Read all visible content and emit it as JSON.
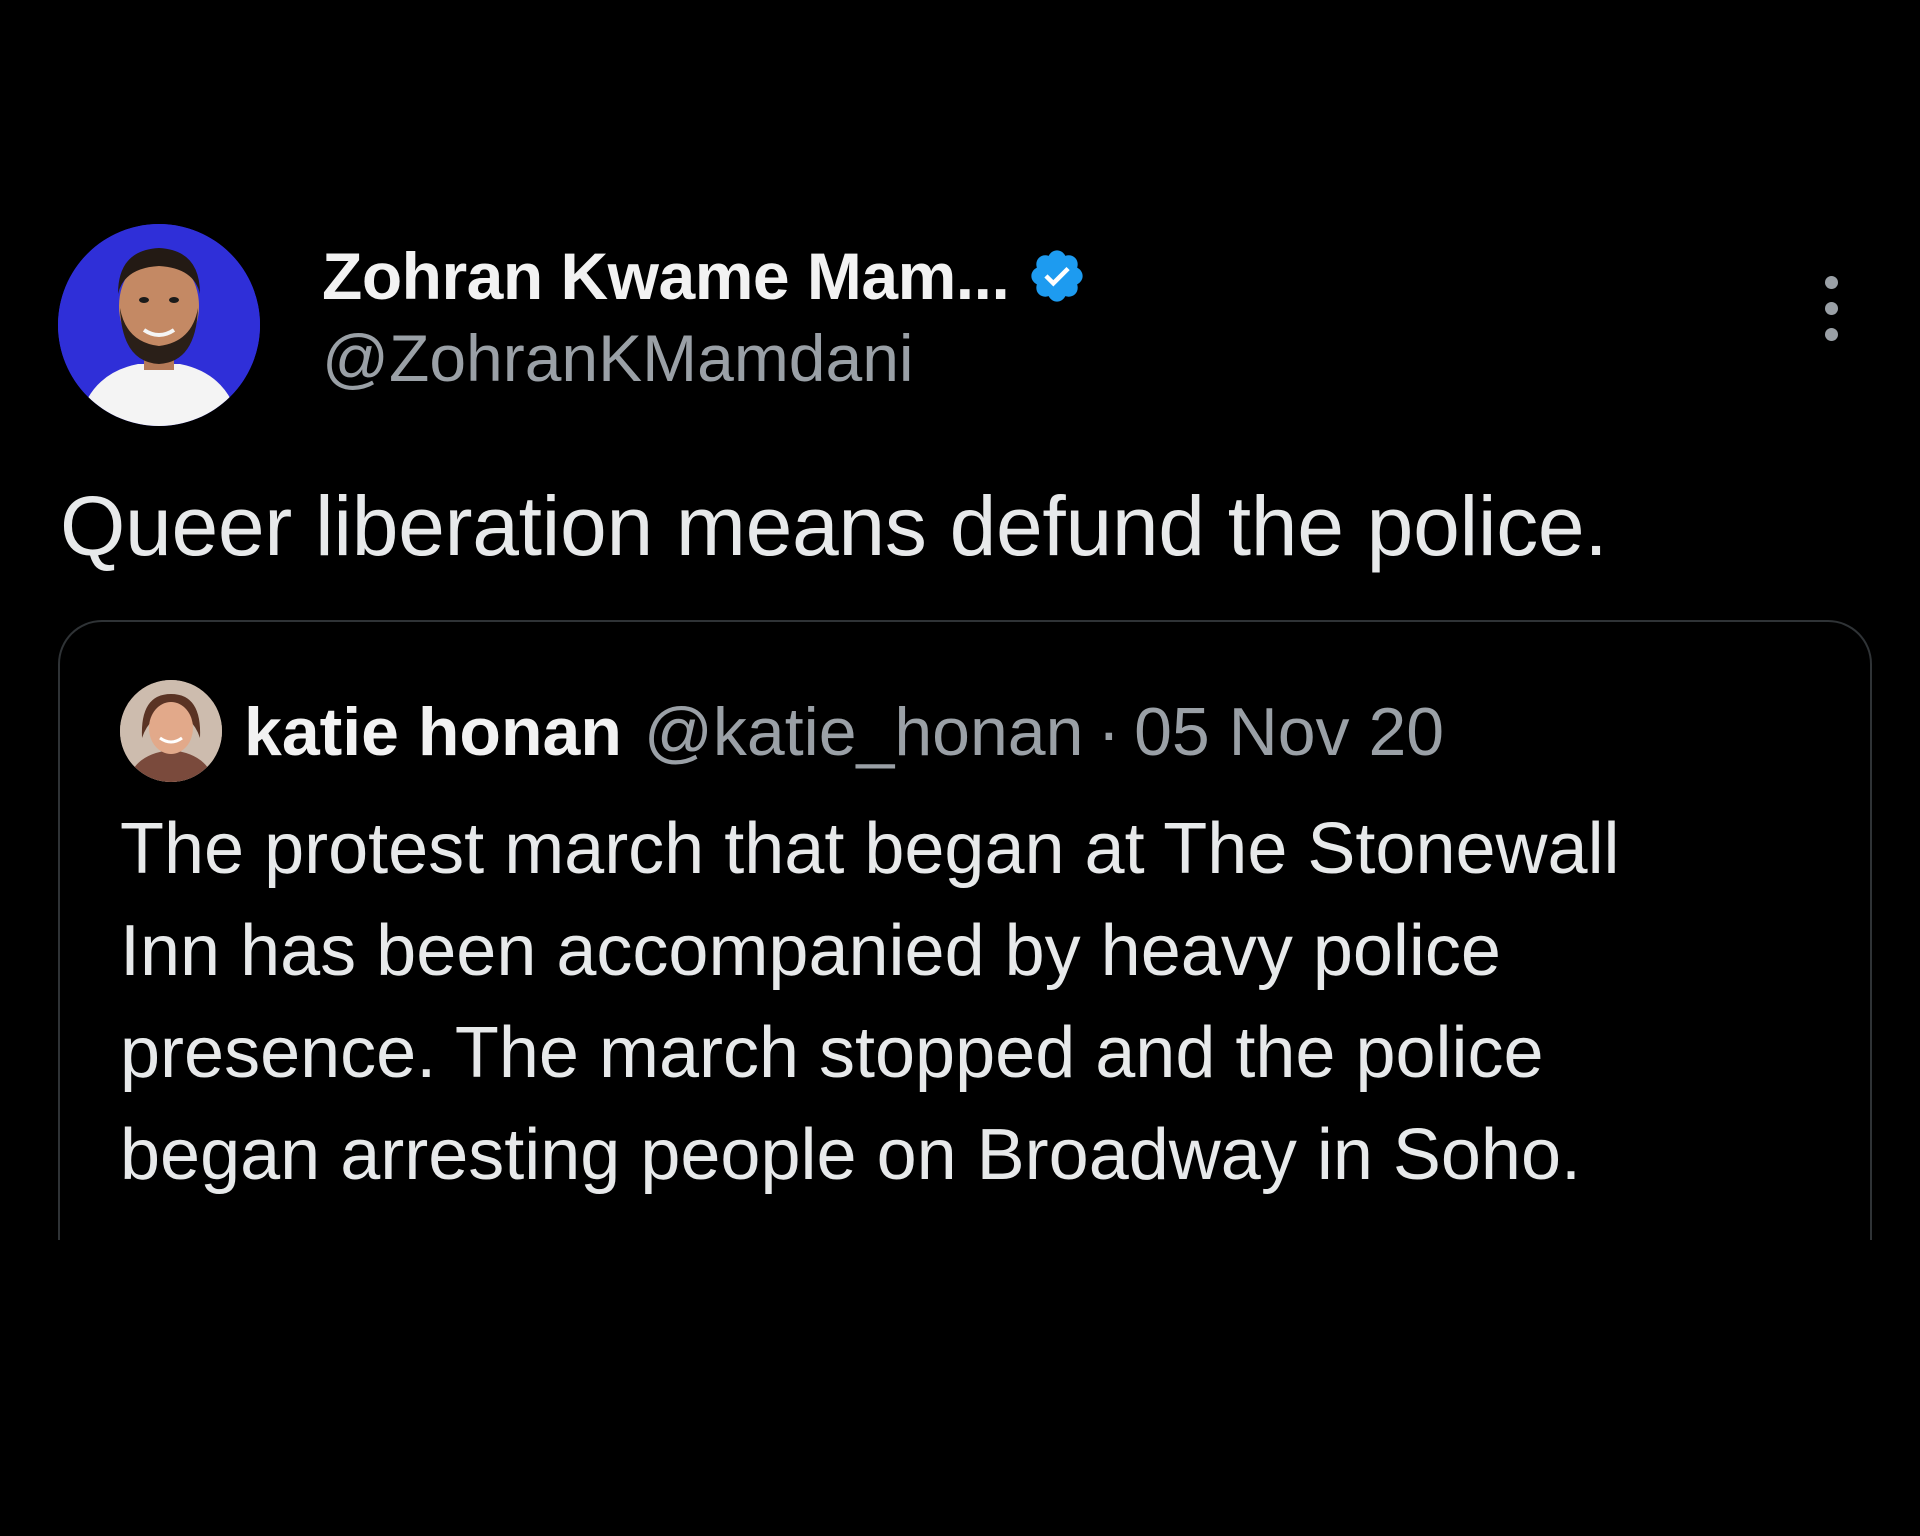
{
  "tweet": {
    "author": {
      "display_name": "Zohran Kwame Mam...",
      "handle": "@ZohranKMamdani",
      "verified_icon": "verified-badge-icon",
      "avatar_icon": "profile-avatar"
    },
    "more_icon": "more-options-icon",
    "text": "Queer liberation means defund the police.",
    "quoted": {
      "display_name": "katie honan",
      "handle": "@katie_honan",
      "separator": "·",
      "date": "05 Nov 20",
      "avatar_icon": "profile-avatar",
      "lines": [
        "The protest march that began at The Stonewall",
        "Inn has been accompanied by heavy police",
        "presence. The march stopped and the police",
        "began arresting people on Broadway in Soho."
      ]
    }
  },
  "colors": {
    "background": "#000000",
    "text_primary": "#e7e9ea",
    "text_secondary": "#9aa0a6",
    "verified": "#1d9bf0",
    "avatar_bg": "#2f2fd8",
    "quote_border": "#2f3336"
  }
}
